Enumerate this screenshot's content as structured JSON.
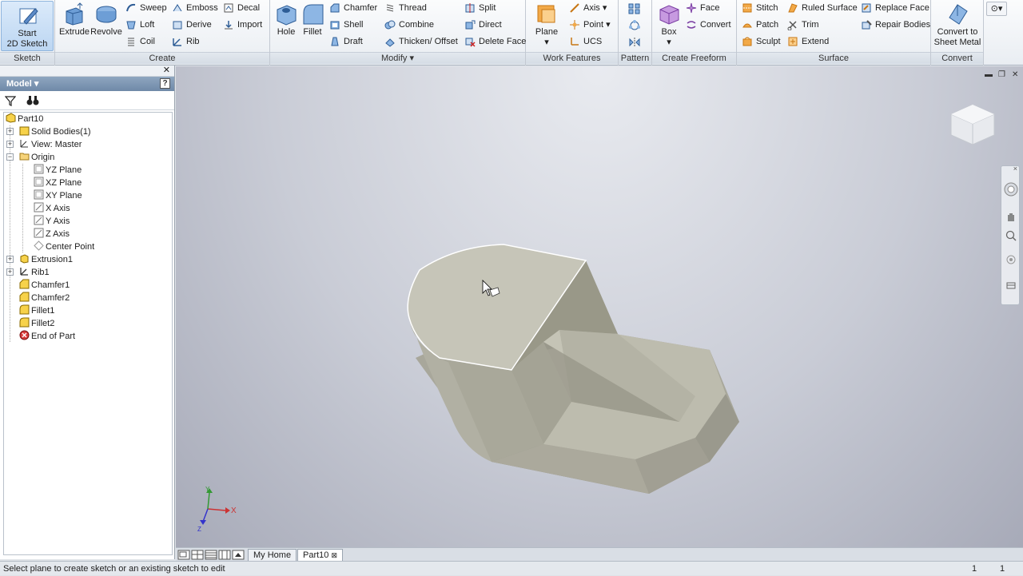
{
  "ribbon": {
    "sketch": {
      "start_label_1": "Start",
      "start_label_2": "2D Sketch",
      "panel": "Sketch"
    },
    "create": {
      "panel": "Create",
      "extrude": "Extrude",
      "revolve": "Revolve",
      "sweep": "Sweep",
      "loft": "Loft",
      "coil": "Coil",
      "emboss": "Emboss",
      "derive": "Derive",
      "rib": "Rib",
      "decal": "Decal",
      "import": "Import"
    },
    "modify": {
      "panel": "Modify",
      "hole": "Hole",
      "fillet": "Fillet",
      "chamfer": "Chamfer",
      "shell": "Shell",
      "draft": "Draft",
      "thread": "Thread",
      "combine": "Combine",
      "thicken": "Thicken/ Offset",
      "split": "Split",
      "direct": "Direct",
      "delete_face": "Delete Face"
    },
    "work_features": {
      "panel": "Work Features",
      "plane": "Plane",
      "axis": "Axis",
      "point": "Point",
      "ucs": "UCS"
    },
    "pattern": {
      "panel": "Pattern"
    },
    "create_freeform": {
      "panel": "Create Freeform",
      "box": "Box",
      "face": "Face",
      "convert": "Convert"
    },
    "surface": {
      "panel": "Surface",
      "stitch": "Stitch",
      "patch": "Patch",
      "sculpt": "Sculpt",
      "ruled_surface": "Ruled Surface",
      "trim": "Trim",
      "extend": "Extend",
      "replace_face": "Replace Face",
      "repair_bodies": "Repair Bodies"
    },
    "convert": {
      "panel": "Convert",
      "label_1": "Convert to",
      "label_2": "Sheet Metal"
    }
  },
  "browser": {
    "title": "Model",
    "help": "?",
    "tree": [
      {
        "label": "Part10",
        "icon": "part-icon"
      },
      {
        "label": "Solid Bodies(1)",
        "icon": "solid-bodies-icon"
      },
      {
        "label": "View: Master",
        "icon": "view-icon"
      },
      {
        "label": "Origin",
        "icon": "folder-icon"
      },
      {
        "label": "YZ Plane",
        "icon": "plane-icon"
      },
      {
        "label": "XZ Plane",
        "icon": "plane-icon"
      },
      {
        "label": "XY Plane",
        "icon": "plane-icon"
      },
      {
        "label": "X Axis",
        "icon": "axis-icon"
      },
      {
        "label": "Y Axis",
        "icon": "axis-icon"
      },
      {
        "label": "Z Axis",
        "icon": "axis-icon"
      },
      {
        "label": "Center Point",
        "icon": "point-icon"
      },
      {
        "label": "Extrusion1",
        "icon": "extrusion-icon"
      },
      {
        "label": "Rib1",
        "icon": "rib-icon"
      },
      {
        "label": "Chamfer1",
        "icon": "chamfer-icon"
      },
      {
        "label": "Chamfer2",
        "icon": "chamfer-icon"
      },
      {
        "label": "Fillet1",
        "icon": "fillet-icon"
      },
      {
        "label": "Fillet2",
        "icon": "fillet-icon"
      },
      {
        "label": "End of Part",
        "icon": "end-of-part-icon"
      }
    ]
  },
  "triad": {
    "x": "X",
    "y": "Y",
    "z": "Z"
  },
  "tabs": {
    "home": "My Home",
    "part": "Part10"
  },
  "status": {
    "message": "Select plane to create sketch or an existing sketch to edit",
    "count_1": "1",
    "count_2": "1"
  },
  "colors": {
    "accent": "#3f6fb0",
    "model": "#b3b2a6"
  }
}
